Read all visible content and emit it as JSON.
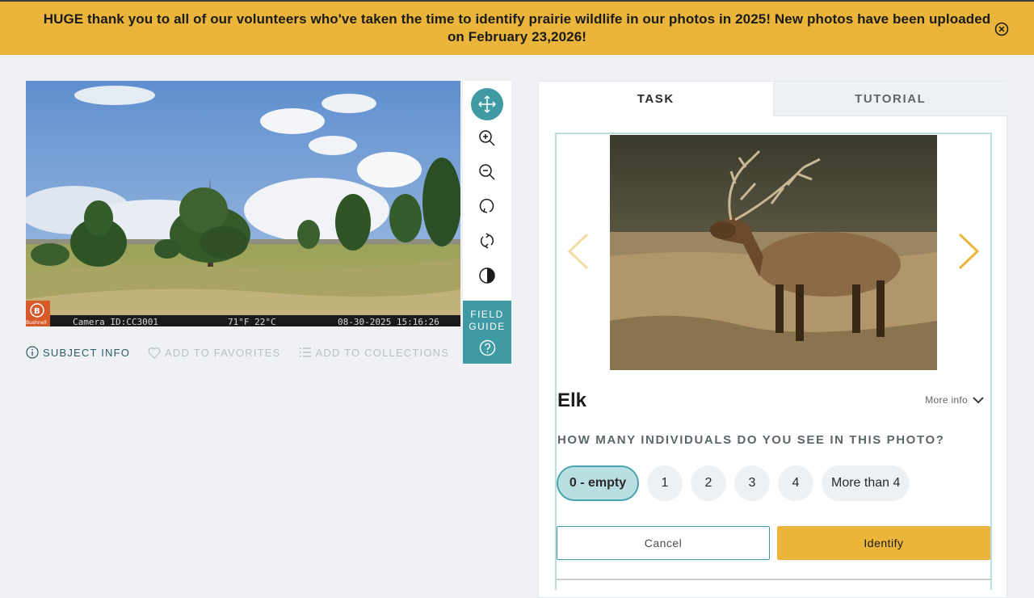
{
  "banner": {
    "message": "HUGE thank you to all of our volunteers who've taken the time to identify prairie wildlife in our photos in 2025! New photos have been uploaded on February 23,2026!",
    "close_icon": "close-circle-icon"
  },
  "subject": {
    "camera_brand": "Bushnell",
    "camera_id": "Camera ID:CC3001",
    "temperature": "71°F 22°C",
    "date_time": "08-30-2025 15:16:26"
  },
  "toolbar": {
    "tools": [
      "move-icon",
      "zoom-in-icon",
      "zoom-out-icon",
      "rotate-icon",
      "reset-icon",
      "invert-icon"
    ],
    "field_guide_label": "FIELD GUIDE",
    "field_guide_icon": "help-circle-icon"
  },
  "meta": {
    "subject_info": "SUBJECT INFO",
    "add_to_favorites": "ADD TO FAVORITES",
    "add_to_collections": "ADD TO COLLECTIONS"
  },
  "tabs": {
    "task": "TASK",
    "tutorial": "TUTORIAL"
  },
  "task": {
    "species_name": "Elk",
    "more_info": "More info",
    "question": "HOW MANY INDIVIDUALS DO YOU SEE IN THIS PHOTO?",
    "answers": [
      "0 - empty",
      "1",
      "2",
      "3",
      "4",
      "More than 4"
    ],
    "selected_answer": "0 - empty",
    "cancel_label": "Cancel",
    "identify_label": "Identify"
  },
  "colors": {
    "banner": "#eab53a",
    "teal": "#3f9aa3",
    "identify": "#eab53a",
    "page_bg": "#eff1f4"
  }
}
